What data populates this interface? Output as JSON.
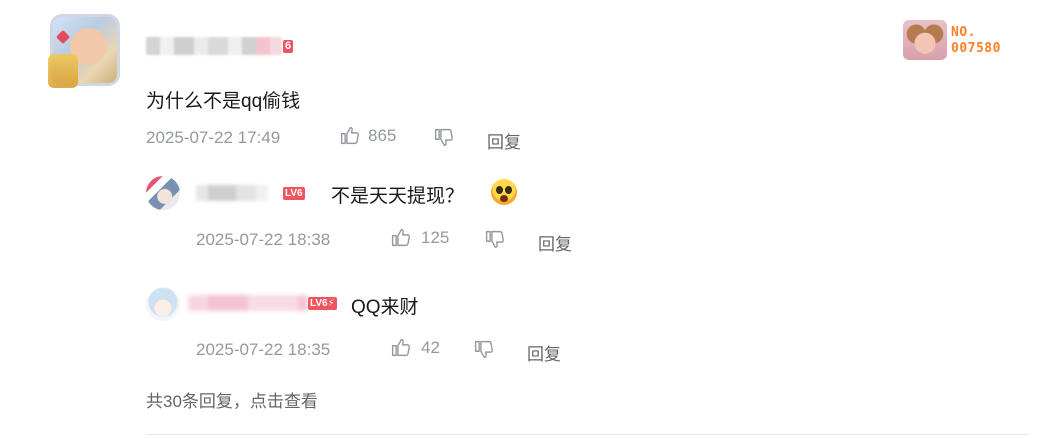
{
  "main_comment": {
    "level_badge": "6",
    "text": "为什么不是qq偷钱",
    "timestamp": "2025-07-22 17:49",
    "like_count": "865",
    "reply_label": "回复"
  },
  "fan_card": {
    "line1": "NO.",
    "line2": "007580"
  },
  "replies": [
    {
      "level_badge": "LV6",
      "text": "不是天天提现？",
      "timestamp": "2025-07-22 18:38",
      "like_count": "125",
      "reply_label": "回复"
    },
    {
      "level_badge": "LV6⚡",
      "text": "QQ来财",
      "timestamp": "2025-07-22 18:35",
      "like_count": "42",
      "reply_label": "回复"
    }
  ],
  "more_replies": "共30条回复，点击查看",
  "icons": {
    "like": "thumbs-up-icon",
    "dislike": "thumbs-down-icon",
    "emoji": "shocked-emoji-icon"
  },
  "colors": {
    "level_badge": "#f0545e",
    "fan_number": "#ff7f24",
    "meta_text": "#9499a0"
  }
}
